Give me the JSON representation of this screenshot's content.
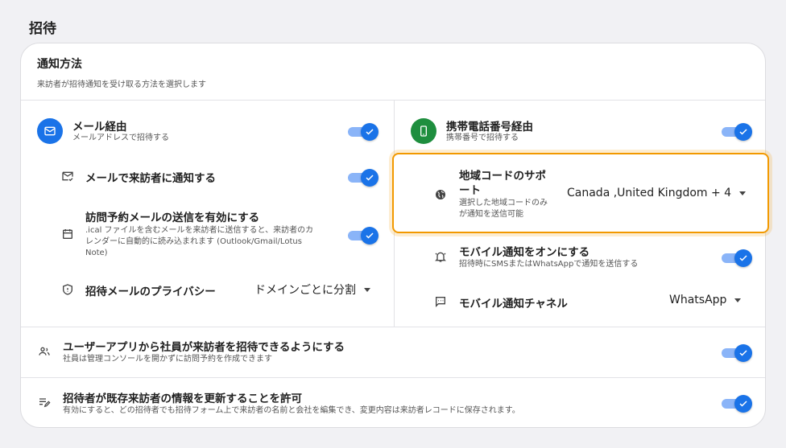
{
  "section": {
    "title": "招待"
  },
  "card": {
    "title": "通知方法",
    "description": "来訪者が招待通知を受け取る方法を選択します"
  },
  "left": {
    "email": {
      "label": "メール経由",
      "desc": "メールアドレスで招待する",
      "enabled": true,
      "icon": "mail-icon"
    },
    "notify": {
      "label": "メールで来訪者に通知する",
      "enabled": true,
      "icon": "mail-check-icon"
    },
    "ical": {
      "label": "訪問予約メールの送信を有効にする",
      "desc_line1": ".ical ファイルを含むメールを来訪者に送信すると、来訪者のカ",
      "desc_line2": "レンダーに自動的に読み込まれます (Outlook/Gmail/Lotus",
      "desc_line3": "Note)",
      "enabled": true,
      "icon": "calendar-icon"
    },
    "privacy": {
      "label": "招待メールのプライバシー",
      "value": "ドメインごとに分割",
      "icon": "shield-icon"
    }
  },
  "right": {
    "phone": {
      "label": "携帯電話番号経由",
      "desc": "携帯番号で招待する",
      "enabled": true,
      "icon": "phone-icon"
    },
    "region": {
      "label_line1": "地域コードのサポ",
      "label_line2": "ート",
      "desc_line1": "選択した地域コードのみ",
      "desc_line2": "が通知を送信可能",
      "value": "Canada ,United Kingdom + 4",
      "icon": "globe-icon"
    },
    "mobile_notify": {
      "label": "モバイル通知をオンにする",
      "desc": "招待時にSMSまたはWhatsAppで通知を送信する",
      "enabled": true,
      "icon": "bell-icon"
    },
    "channel": {
      "label": "モバイル通知チャネル",
      "value": "WhatsApp",
      "icon": "message-icon"
    }
  },
  "bottom": {
    "user_app": {
      "label": "ユーザーアプリから社員が来訪者を招待できるようにする",
      "desc": "社員は管理コンソールを開かずに訪問予約を作成できます",
      "enabled": true,
      "icon": "people-icon"
    },
    "update": {
      "label": "招待者が既存来訪者の情報を更新することを許可",
      "desc": "有効にすると、どの招待者でも招待フォーム上で来訪者の名前と会社を編集でき、変更内容は来訪者レコードに保存されます。",
      "enabled": true,
      "icon": "edit-list-icon"
    }
  },
  "colors": {
    "accent": "#1a73e8",
    "accent_track": "#8ab4f8",
    "phone_green": "#1e8e3e",
    "highlight": "#f29900"
  }
}
